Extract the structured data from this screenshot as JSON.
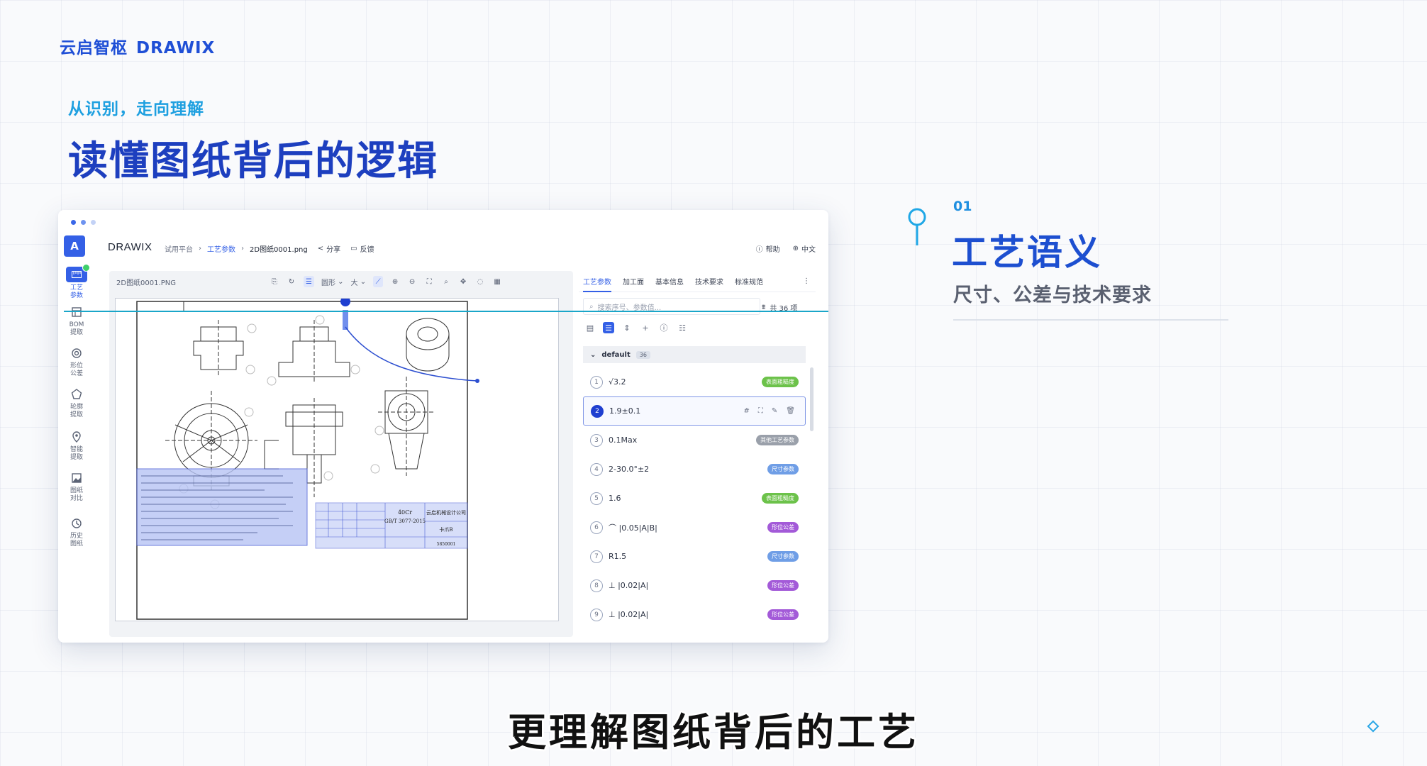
{
  "brand": {
    "cn": "云启智枢",
    "en": "DRAWIX"
  },
  "tagline": "从识别，走向理解",
  "headline": "读懂图纸背后的逻辑",
  "window": {
    "dot_colors": [
      "#3a67e8",
      "#6e93f0",
      "#c3d2f6"
    ],
    "app_title": "DRAWIX",
    "logo_letter": "A",
    "breadcrumbs": [
      "试用平台",
      "工艺参数",
      "2D图纸0001.png"
    ],
    "share_label": "分享",
    "feedback_label": "反馈",
    "help_label": "帮助",
    "lang_label": "中文",
    "sidebar": [
      {
        "label_line1": "工艺",
        "label_line2": "参数",
        "icon": "ruler-icon",
        "active": true
      },
      {
        "label_line1": "BOM",
        "label_line2": "提取",
        "icon": "table-icon"
      },
      {
        "label_line1": "形位",
        "label_line2": "公差",
        "icon": "target-icon"
      },
      {
        "label_line1": "轮廓",
        "label_line2": "提取",
        "icon": "pentagon-icon"
      },
      {
        "label_line1": "智能",
        "label_line2": "提取",
        "icon": "location-pin-icon"
      },
      {
        "label_line1": "图纸",
        "label_line2": "对比",
        "icon": "image-compare-icon"
      },
      {
        "label_line1": "历史",
        "label_line2": "图纸",
        "icon": "history-icon"
      }
    ],
    "drawing": {
      "file_name": "2D图纸0001.PNG",
      "shape_label": "圆形",
      "size_label": "大",
      "title_block_material": "40Cr",
      "title_block_standard": "GB/T 3077-2015",
      "title_block_company": "云启机械设计公司",
      "title_block_part": "卡爪B",
      "title_block_drawing_no": "5850001"
    },
    "right_panel": {
      "tabs": [
        "工艺参数",
        "加工面",
        "基本信息",
        "技术要求",
        "标准规范"
      ],
      "active_tab": 0,
      "search_placeholder": "搜索序号、参数值...",
      "count_label": "共 36 项",
      "group_name": "default",
      "group_count": "36",
      "items": [
        {
          "num": "1",
          "value": "√3.2",
          "tag": "表面粗糙度",
          "tag_color": "#6cc24a"
        },
        {
          "num": "2",
          "value": "1.9±0.1",
          "tag": "",
          "tag_color": "",
          "selected": true
        },
        {
          "num": "3",
          "value": "0.1Max",
          "tag": "其他工艺参数",
          "tag_color": "#9aa0aa"
        },
        {
          "num": "4",
          "value": "2-30.0°±2",
          "tag": "尺寸参数",
          "tag_color": "#6f9ee6"
        },
        {
          "num": "5",
          "value": "1.6",
          "tag": "表面粗糙度",
          "tag_color": "#6cc24a"
        },
        {
          "num": "6",
          "value": "⌒ |0.05|A|B|",
          "tag": "形位公差",
          "tag_color": "#a35ad8"
        },
        {
          "num": "7",
          "value": "R1.5",
          "tag": "尺寸参数",
          "tag_color": "#6f9ee6"
        },
        {
          "num": "8",
          "value": "⊥ |0.02|A|",
          "tag": "形位公差",
          "tag_color": "#a35ad8"
        },
        {
          "num": "9",
          "value": "⊥ |0.02|A|",
          "tag": "形位公差",
          "tag_color": "#a35ad8"
        }
      ]
    }
  },
  "info": {
    "number": "01",
    "title": "工艺语义",
    "subtitle": "尺寸、公差与技术要求"
  },
  "caption": "更理解图纸背后的工艺"
}
